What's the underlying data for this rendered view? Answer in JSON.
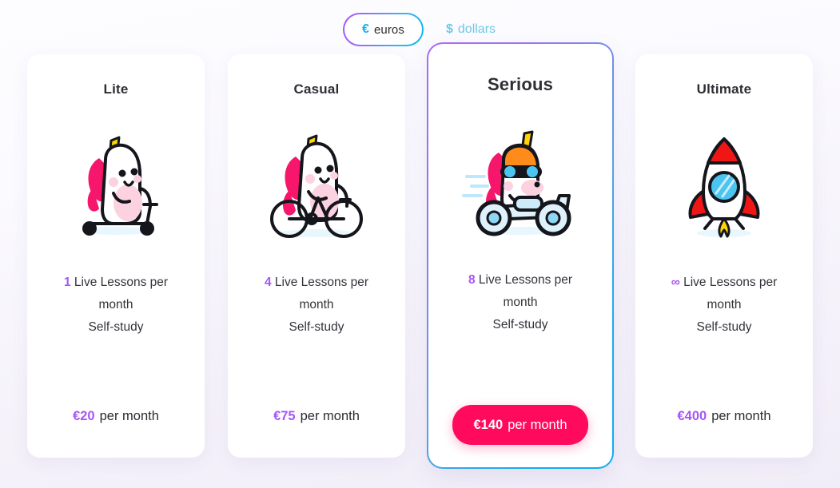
{
  "currency_toggle": {
    "active": {
      "symbol": "€",
      "label": "euros",
      "icon": "euro-symbol"
    },
    "inactive": {
      "symbol": "$",
      "label": "dollars",
      "icon": "dollar-symbol"
    }
  },
  "accent_colors": {
    "purple": "#a855f7",
    "cyan": "#0bb3f7",
    "pink": "#ff0a5c",
    "text_dark": "#2e2e35",
    "inactive_teal": "#6fc9e3",
    "card_bg": "#ffffff",
    "page_bg": "#f4f1fa"
  },
  "plans": [
    {
      "title": "Lite",
      "illustration": "unicorn-on-scooter",
      "featured": false,
      "lessons_count": "1",
      "lessons_text": "Live Lessons per",
      "lessons_period": "month",
      "extra_feature": "Self-study",
      "price": "€20",
      "price_period": "per month"
    },
    {
      "title": "Casual",
      "illustration": "unicorn-on-bicycle",
      "featured": false,
      "lessons_count": "4",
      "lessons_text": "Live Lessons per",
      "lessons_period": "month",
      "extra_feature": "Self-study",
      "price": "€75",
      "price_period": "per month"
    },
    {
      "title": "Serious",
      "illustration": "unicorn-on-motorcycle",
      "featured": true,
      "lessons_count": "8",
      "lessons_text": "Live Lessons per",
      "lessons_period": "month",
      "extra_feature": "Self-study",
      "price": "€140",
      "price_period": "per month"
    },
    {
      "title": "Ultimate",
      "illustration": "rocket",
      "featured": false,
      "lessons_count": "∞",
      "lessons_text": "Live Lessons per",
      "lessons_period": "month",
      "extra_feature": "Self-study",
      "price": "€400",
      "price_period": "per month"
    }
  ]
}
